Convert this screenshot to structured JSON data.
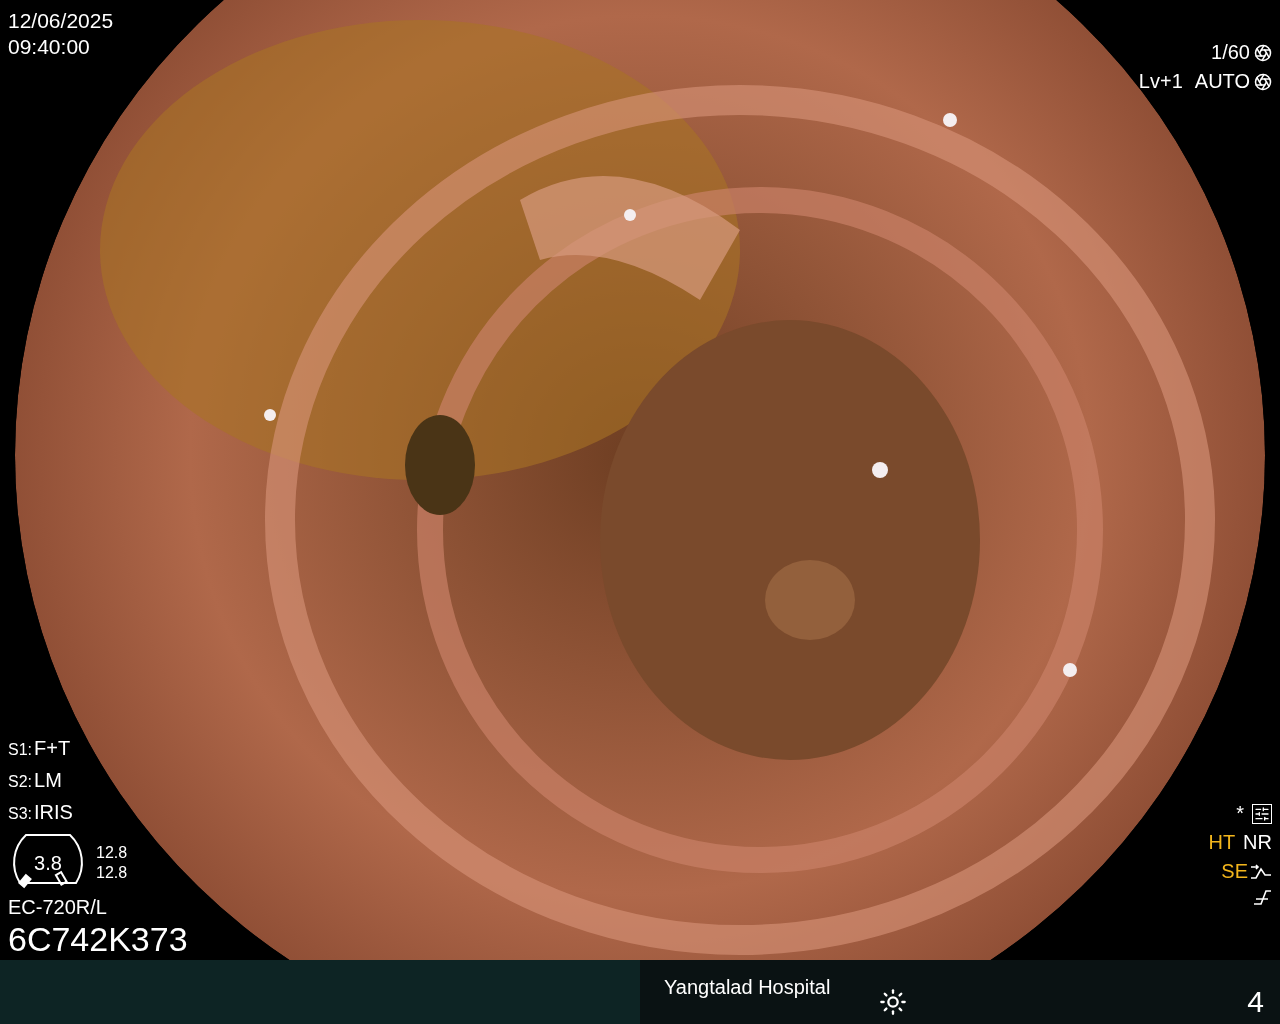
{
  "datetime": {
    "date": "12/06/2025",
    "time": "09:40:00"
  },
  "exposure": {
    "shutter": "1/60",
    "level": "Lv+1",
    "iris_mode": "AUTO"
  },
  "switches": [
    {
      "key": "S1:",
      "value": "F+T"
    },
    {
      "key": "S2:",
      "value": "LM"
    },
    {
      "key": "S3:",
      "value": "IRIS"
    }
  ],
  "zoom": {
    "value": "3.8",
    "readings": [
      "12.8",
      "12.8"
    ]
  },
  "scope": {
    "model": "EC-720R/L",
    "serial": "6C742K373"
  },
  "enhancement": {
    "mark": "*",
    "modes": [
      {
        "label": "HT",
        "active": true
      },
      {
        "label": "NR",
        "active": false
      },
      {
        "label": "SE",
        "active": true
      }
    ]
  },
  "footer": {
    "hospital": "Yangtalad Hospital",
    "counter": "4"
  }
}
